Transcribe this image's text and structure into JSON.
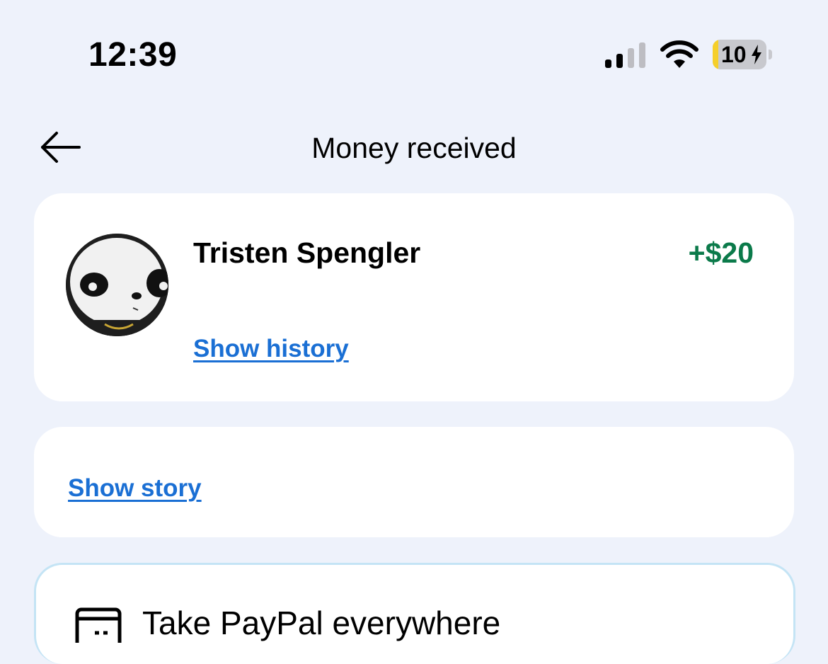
{
  "status_bar": {
    "time": "12:39",
    "battery_percent": 10,
    "battery_label": "10",
    "charging": true,
    "signal_bars_active": 2,
    "signal_bars_total": 4
  },
  "header": {
    "title": "Money received",
    "back_icon": "arrow-left-icon"
  },
  "transaction": {
    "sender_name": "Tristen Spengler",
    "amount": "+$20",
    "amount_color": "#0b7a4a",
    "history_link": "Show history"
  },
  "story": {
    "link": "Show story"
  },
  "promo": {
    "title": "Take PayPal everywhere",
    "icon": "card-icon"
  },
  "colors": {
    "background": "#eef2fb",
    "link": "#1a6fd4",
    "promo_border": "#c4e4f5"
  }
}
